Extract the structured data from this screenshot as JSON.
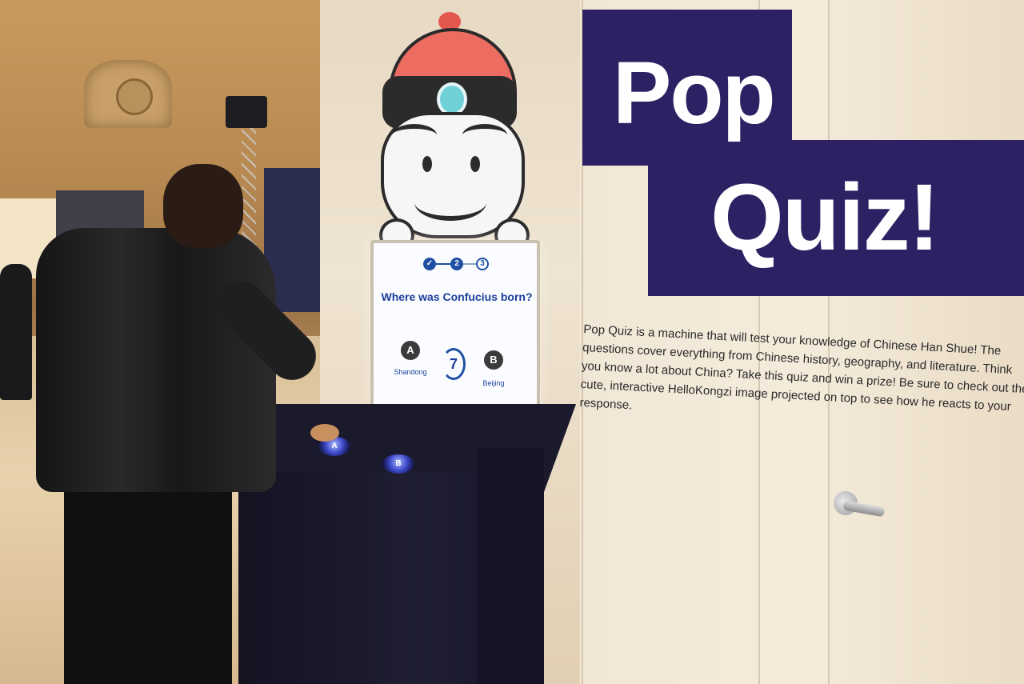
{
  "exhibit": {
    "sign_title_line1": "Pop",
    "sign_title_line2": "Quiz!",
    "description": "Pop Quiz is a machine that will test your knowledge of Chinese Han Shue! The questions cover everything from Chinese history, geography, and literature. Think you know a lot about China? Take this quiz and win a prize! Be sure to check out the cute, interactive HelloKongzi image projected on top to see how he reacts to your response."
  },
  "quiz_screen": {
    "progress_steps": [
      "✓",
      "2",
      "3"
    ],
    "question": "Where was Confucius born?",
    "option_a_badge": "A",
    "option_a_text": "Shandong",
    "option_b_badge": "B",
    "option_b_text": "Beijing",
    "timer_value": "7"
  },
  "console": {
    "button_a_label": "A",
    "button_b_label": "B"
  },
  "colors": {
    "sign_purple": "#2d2163",
    "screen_blue": "#1a3f9a",
    "hat_red": "#ec6c62"
  }
}
